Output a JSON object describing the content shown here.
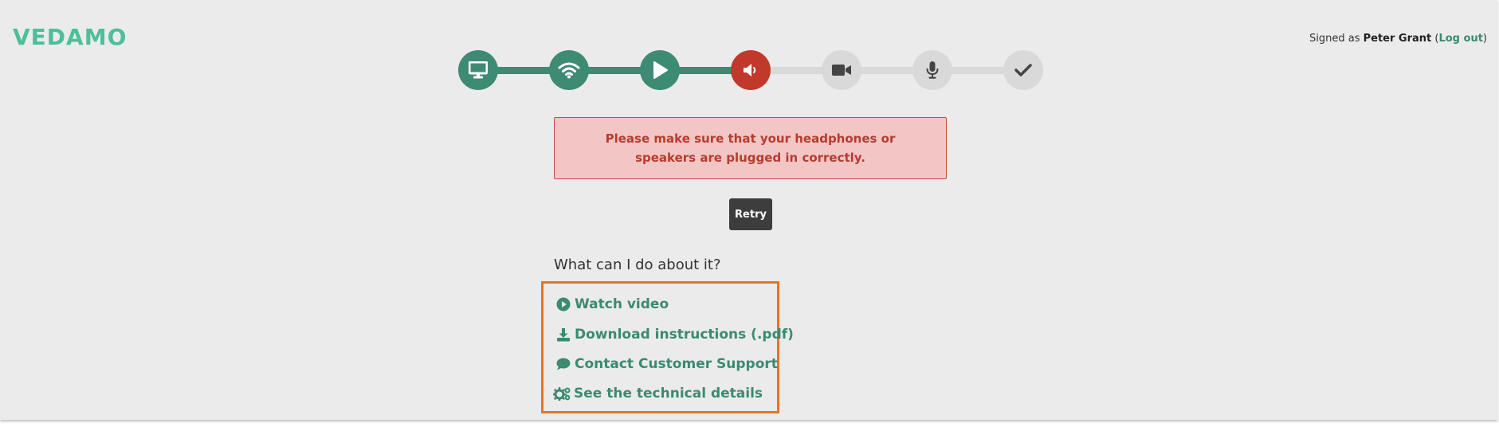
{
  "brand": {
    "logo": "VEDAMO"
  },
  "user": {
    "signed_prefix": "Signed as ",
    "name": "Peter Grant",
    "open_paren": " (",
    "logout": "Log out",
    "close_paren": ")"
  },
  "steps": [
    {
      "icon": "monitor-icon",
      "status": "done"
    },
    {
      "icon": "wifi-icon",
      "status": "done"
    },
    {
      "icon": "play-icon",
      "status": "done"
    },
    {
      "icon": "speaker-icon",
      "status": "error"
    },
    {
      "icon": "video-camera-icon",
      "status": "pending"
    },
    {
      "icon": "microphone-icon",
      "status": "pending"
    },
    {
      "icon": "checkmark-icon",
      "status": "pending"
    }
  ],
  "alert": {
    "message": "Please make sure that your headphones or speakers are plugged in correctly."
  },
  "retry_label": "Retry",
  "help": {
    "question": "What can I do about it?",
    "links": [
      {
        "icon": "play-circle-icon",
        "label": "Watch video"
      },
      {
        "icon": "download-icon",
        "label": "Download instructions (.pdf)"
      },
      {
        "icon": "chat-bubble-icon",
        "label": "Contact Customer Support"
      },
      {
        "icon": "gears-icon",
        "label": "See the technical details"
      }
    ]
  },
  "colors": {
    "accent": "#3e8b73",
    "error": "#c0392b",
    "pending": "#d9d9d9",
    "highlight_border": "#e8741f"
  }
}
